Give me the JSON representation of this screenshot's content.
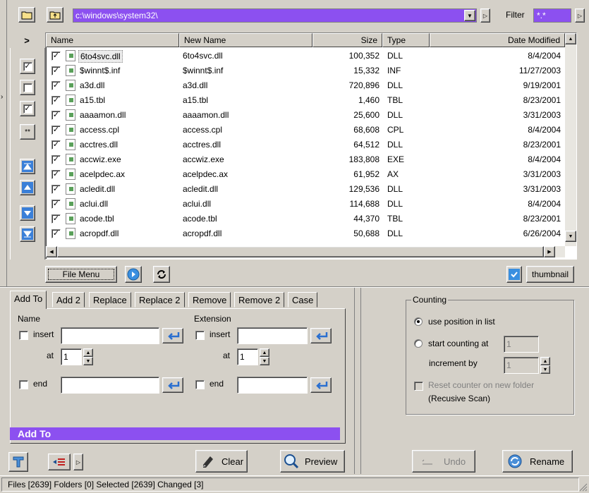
{
  "toolbar": {
    "path": "c:\\windows\\system32\\",
    "filter_label": "Filter",
    "filter_value": "*.*"
  },
  "columns": [
    "Name",
    "New Name",
    "Size",
    "Type",
    "Date Modified"
  ],
  "files": [
    {
      "name": "6to4svc.dll",
      "new": "6to4svc.dll",
      "size": "100,352",
      "type": "DLL",
      "date": "8/4/2004"
    },
    {
      "name": "$winnt$.inf",
      "new": "$winnt$.inf",
      "size": "15,332",
      "type": "INF",
      "date": "11/27/2003"
    },
    {
      "name": "a3d.dll",
      "new": "a3d.dll",
      "size": "720,896",
      "type": "DLL",
      "date": "9/19/2001"
    },
    {
      "name": "a15.tbl",
      "new": "a15.tbl",
      "size": "1,460",
      "type": "TBL",
      "date": "8/23/2001"
    },
    {
      "name": "aaaamon.dll",
      "new": "aaaamon.dll",
      "size": "25,600",
      "type": "DLL",
      "date": "3/31/2003"
    },
    {
      "name": "access.cpl",
      "new": "access.cpl",
      "size": "68,608",
      "type": "CPL",
      "date": "8/4/2004"
    },
    {
      "name": "acctres.dll",
      "new": "acctres.dll",
      "size": "64,512",
      "type": "DLL",
      "date": "8/23/2001"
    },
    {
      "name": "accwiz.exe",
      "new": "accwiz.exe",
      "size": "183,808",
      "type": "EXE",
      "date": "8/4/2004"
    },
    {
      "name": "acelpdec.ax",
      "new": "acelpdec.ax",
      "size": "61,952",
      "type": "AX",
      "date": "3/31/2003"
    },
    {
      "name": "acledit.dll",
      "new": "acledit.dll",
      "size": "129,536",
      "type": "DLL",
      "date": "3/31/2003"
    },
    {
      "name": "aclui.dll",
      "new": "aclui.dll",
      "size": "114,688",
      "type": "DLL",
      "date": "8/4/2004"
    },
    {
      "name": "acode.tbl",
      "new": "acode.tbl",
      "size": "44,370",
      "type": "TBL",
      "date": "8/23/2001"
    },
    {
      "name": "acropdf.dll",
      "new": "acropdf.dll",
      "size": "50,688",
      "type": "DLL",
      "date": "6/26/2004"
    }
  ],
  "buttons": {
    "file_menu": "File Menu",
    "thumbnail": "thumbnail",
    "clear": "Clear",
    "preview": "Preview",
    "undo": "Undo",
    "rename": "Rename"
  },
  "tabs": [
    "Add To",
    "Add 2",
    "Replace",
    "Replace 2",
    "Remove",
    "Remove 2",
    "Case"
  ],
  "addto": {
    "name_label": "Name",
    "extension_label": "Extension",
    "insert_label": "insert",
    "at_label": "at",
    "end_label": "end",
    "name_at_value": "1",
    "ext_at_value": "1",
    "banner": "Add To"
  },
  "counting": {
    "group_label": "Counting",
    "option1": "use position in list",
    "option2": "start counting at",
    "start_value": "1",
    "increment_label": "increment by",
    "increment_value": "1",
    "reset_line1": "Reset counter on new folder",
    "reset_line2": "(Recusive Scan)"
  },
  "expand_arrow": ">",
  "status": "Files [2639] Folders [0] Selected [2639] Changed [3]",
  "colors": {
    "accent_purple": "#8c50f0",
    "select_blue": "#1f5fb8"
  }
}
